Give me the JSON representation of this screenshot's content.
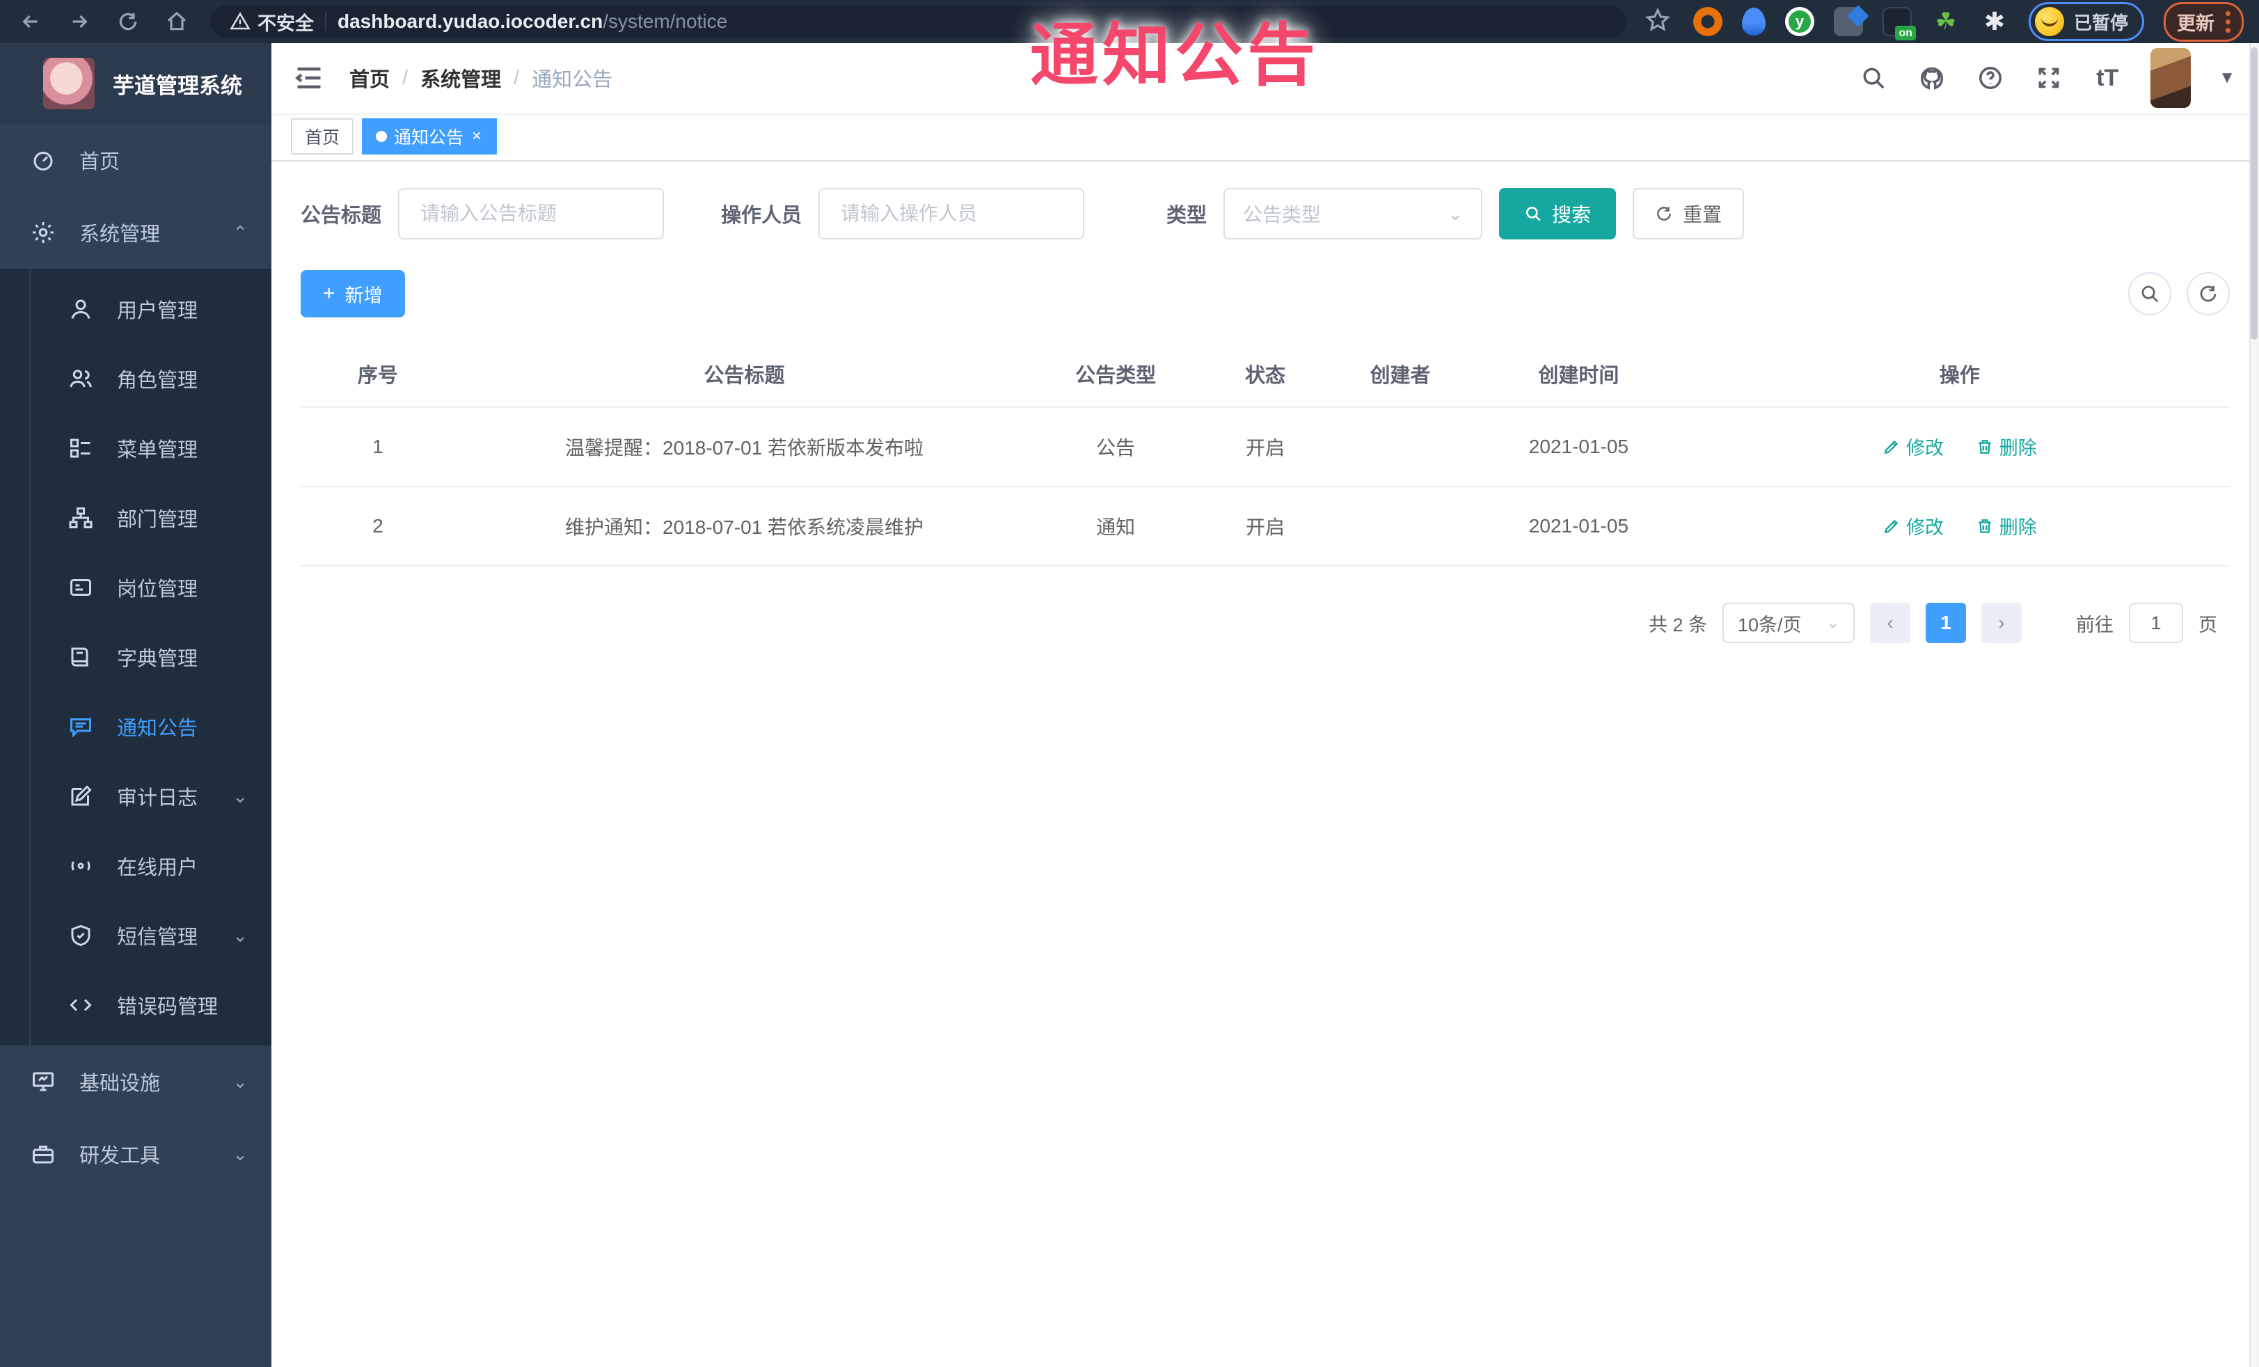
{
  "colors": {
    "accent_blue": "#409eff",
    "accent_teal": "#16a8a0",
    "sidebar_bg": "#304156",
    "submenu_bg": "#1f2d3d",
    "browser_bar_bg": "#222d3c",
    "annotation_pink": "#f4476b",
    "tag_active_bg": "#409eff"
  },
  "annotation": {
    "text": "通知公告"
  },
  "browser": {
    "security_label": "不安全",
    "url_host": "dashboard.yudao.iocoder.cn",
    "url_path": "/system/notice",
    "extension_badge": "on",
    "extension_letter": "y",
    "paused_label": "已暂停",
    "update_label": "更新"
  },
  "sidebar": {
    "title": "芋道管理系统",
    "home": "首页",
    "system": "系统管理",
    "sub": [
      "用户管理",
      "角色管理",
      "菜单管理",
      "部门管理",
      "岗位管理",
      "字典管理",
      "通知公告",
      "审计日志",
      "在线用户",
      "短信管理",
      "错误码管理"
    ],
    "infra": "基础设施",
    "dev": "研发工具"
  },
  "header": {
    "breadcrumb": [
      "首页",
      "系统管理",
      "通知公告"
    ],
    "separator": "/"
  },
  "tabs": {
    "home": "首页",
    "active": "通知公告"
  },
  "filters": {
    "title_label": "公告标题",
    "title_placeholder": "请输入公告标题",
    "operator_label": "操作人员",
    "operator_placeholder": "请输入操作人员",
    "type_label": "类型",
    "type_placeholder": "公告类型",
    "search_label": "搜索",
    "reset_label": "重置"
  },
  "toolbar": {
    "add_label": "新增"
  },
  "table": {
    "columns": [
      "序号",
      "公告标题",
      "公告类型",
      "状态",
      "创建者",
      "创建时间",
      "操作"
    ],
    "edit_label": "修改",
    "delete_label": "删除",
    "rows": [
      {
        "no": "1",
        "title": "温馨提醒：2018-07-01 若依新版本发布啦",
        "type": "公告",
        "status": "开启",
        "creator": "",
        "created": "2021-01-05"
      },
      {
        "no": "2",
        "title": "维护通知：2018-07-01 若依系统凌晨维护",
        "type": "通知",
        "status": "开启",
        "creator": "",
        "created": "2021-01-05"
      }
    ]
  },
  "pagination": {
    "total": "共 2 条",
    "size": "10条/页",
    "prev": "‹",
    "page": "1",
    "next": "›",
    "goto": "前往",
    "goto_value": "1",
    "unit": "页"
  }
}
